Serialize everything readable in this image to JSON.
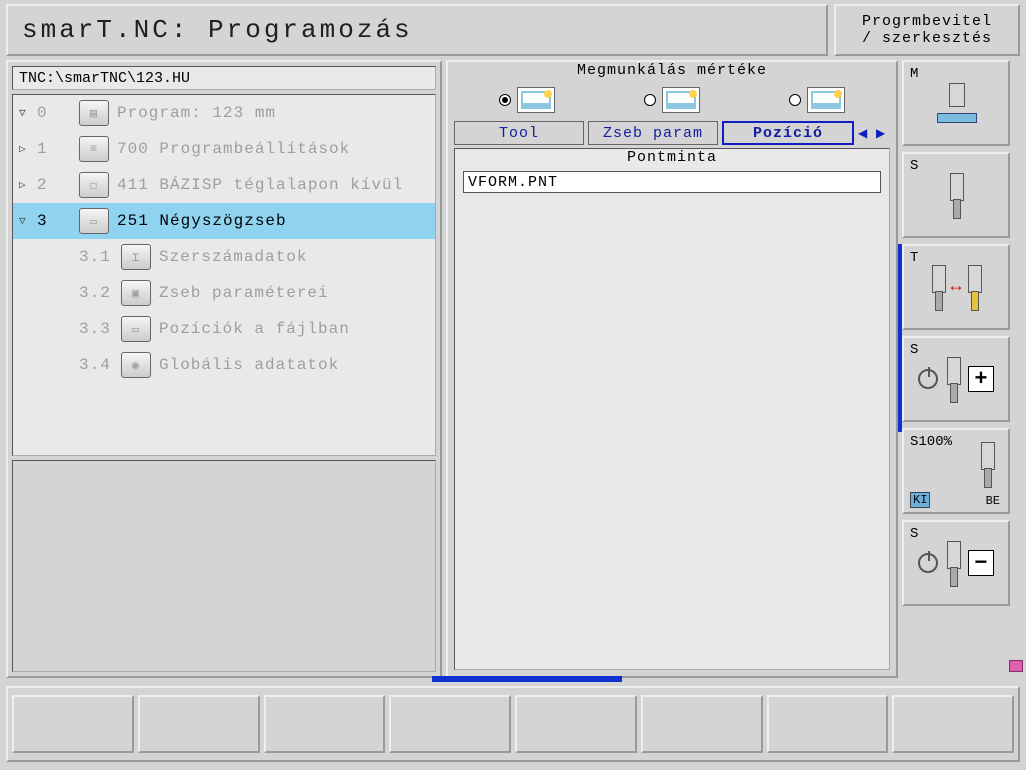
{
  "title": "smarT.NC: Programozás",
  "mode": {
    "line1": "Progrmbevitel",
    "line2": "/ szerkesztés"
  },
  "tree": {
    "path": "TNC:\\smarTNC\\123.HU",
    "rows": [
      {
        "tri": "▽",
        "num": "0",
        "icon": "program-icon",
        "label": "Program: 123 mm",
        "selected": false
      },
      {
        "tri": "▷",
        "num": "1",
        "icon": "settings-icon",
        "label": "700 Programbeállítások",
        "selected": false
      },
      {
        "tri": "▷",
        "num": "2",
        "icon": "base-icon",
        "label": "411 BÁZISP téglalapon kívül",
        "selected": false
      },
      {
        "tri": "▽",
        "num": "3",
        "icon": "pocket-icon",
        "label": "251 Négyszögzseb",
        "selected": true
      },
      {
        "tri": "",
        "num": "3.1",
        "icon": "tooldata-icon",
        "label": "Szerszámadatok",
        "selected": false
      },
      {
        "tri": "",
        "num": "3.2",
        "icon": "pocketparam-icon",
        "label": "Zseb paraméterei",
        "selected": false
      },
      {
        "tri": "",
        "num": "3.3",
        "icon": "positions-icon",
        "label": "Pozíciók a fájlban",
        "selected": false
      },
      {
        "tri": "",
        "num": "3.4",
        "icon": "globe-icon",
        "label": "Globális adatatok",
        "selected": false
      }
    ]
  },
  "detail": {
    "heading": "Megmunkálás mértéke",
    "radio_selected": 0,
    "tabs": [
      "Tool",
      "Zseb param",
      "Pozíció"
    ],
    "active_tab": 2,
    "body_title": "Pontminta",
    "pattern_file": "VFORM.PNT"
  },
  "right_keys": {
    "letters": [
      "M",
      "S",
      "T",
      "S",
      "S100%",
      "S"
    ],
    "opt4": {
      "ki": "KI",
      "be": "BE"
    }
  }
}
